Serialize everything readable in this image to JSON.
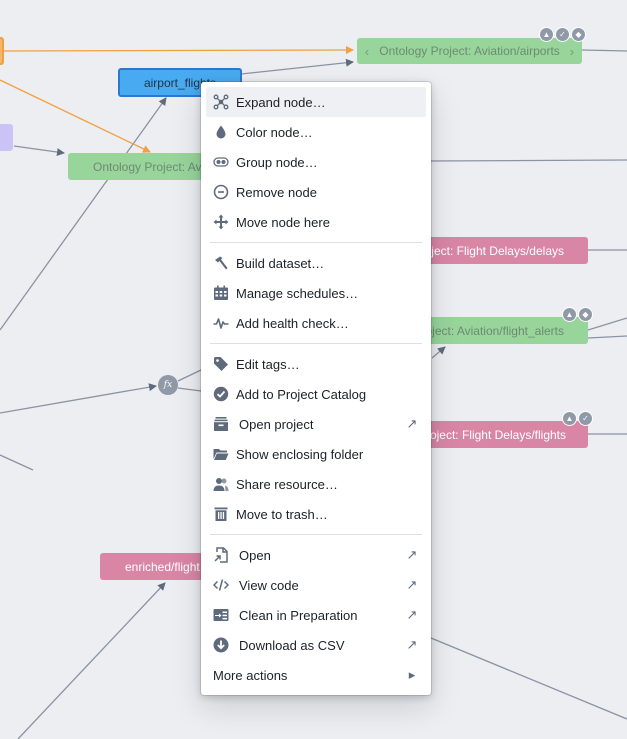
{
  "graph": {
    "nodes": {
      "airport_flights": "airport_flights",
      "aviation_airports": "Ontology Project: Aviation/airports",
      "aviation_partial": "Ontology Project: Aviation/...",
      "flight_delays_delays": "Ontology Project: Flight Delays/delays",
      "aviation_flight_alerts": "Ontology Project: Aviation/flight_alerts",
      "flight_delays_flights": "Ontology Project: Flight Delays/flights",
      "enriched_flight": "enriched/flight..."
    },
    "function_node_label": "fx",
    "colors": {
      "canvas": "#edeef2",
      "edge": "#8a93a3",
      "edge_highlight": "#f0a040",
      "green_node": "#97d59b",
      "pink_node": "#d986a5",
      "blue_node": "#48aaf0",
      "purple_node": "#cbc3f5"
    }
  },
  "menu": {
    "sections": [
      [
        {
          "icon": "expand-node-icon",
          "label": "Expand node…",
          "active": true
        },
        {
          "icon": "droplet-icon",
          "label": "Color node…"
        },
        {
          "icon": "group-icon",
          "label": "Group node…"
        },
        {
          "icon": "remove-circle-icon",
          "label": "Remove node"
        },
        {
          "icon": "move-icon",
          "label": "Move node here"
        }
      ],
      [
        {
          "icon": "hammer-icon",
          "label": "Build dataset…"
        },
        {
          "icon": "calendar-icon",
          "label": "Manage schedules…"
        },
        {
          "icon": "pulse-icon",
          "label": "Add health check…"
        }
      ],
      [
        {
          "icon": "tag-icon",
          "label": "Edit tags…"
        },
        {
          "icon": "badge-check-icon",
          "label": "Add to Project Catalog"
        },
        {
          "icon": "archive-icon",
          "label": "Open project",
          "external": true
        },
        {
          "icon": "folder-open-icon",
          "label": "Show enclosing folder"
        },
        {
          "icon": "people-icon",
          "label": "Share resource…"
        },
        {
          "icon": "trash-icon",
          "label": "Move to trash…"
        }
      ],
      [
        {
          "icon": "open-file-icon",
          "label": "Open",
          "external": true
        },
        {
          "icon": "code-icon",
          "label": "View code",
          "external": true
        },
        {
          "icon": "preparation-icon",
          "label": "Clean in Preparation",
          "external": true
        },
        {
          "icon": "download-icon",
          "label": "Download as CSV",
          "external": true
        }
      ]
    ],
    "more_actions": "More actions",
    "external_glyph": "↗",
    "submenu_glyph": "▸"
  }
}
